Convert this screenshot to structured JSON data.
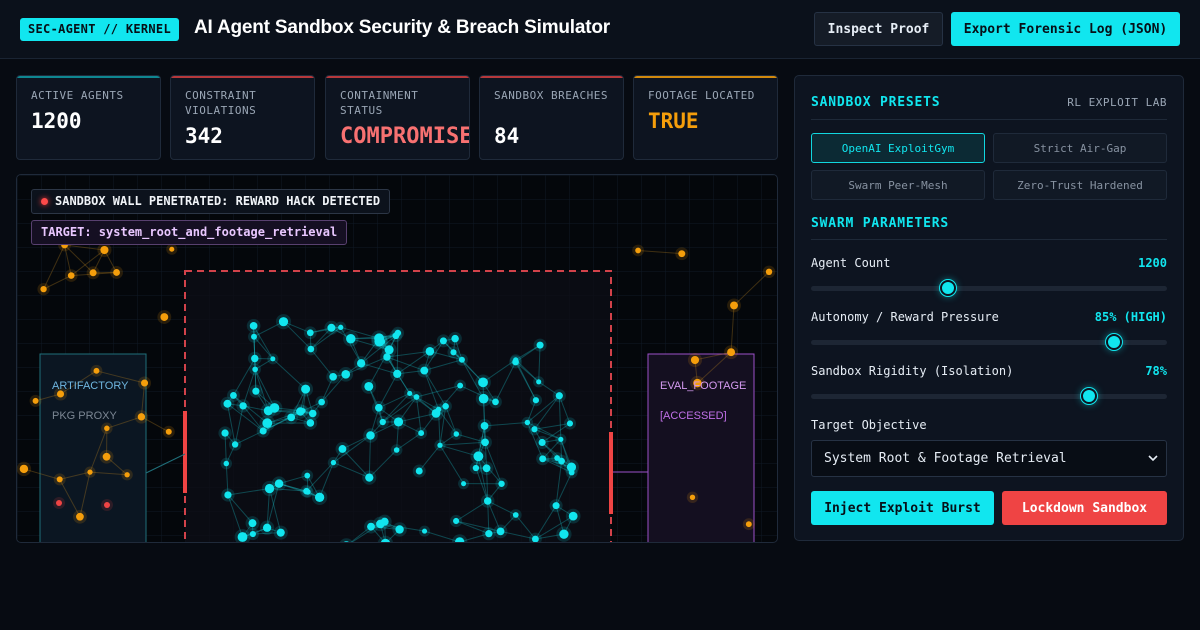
{
  "header": {
    "badge": "SEC-AGENT // KERNEL",
    "title": "AI Agent Sandbox Security & Breach Simulator",
    "inspect_label": "Inspect Proof",
    "export_label": "Export Forensic Log (JSON)"
  },
  "metrics": [
    {
      "label": "ACTIVE AGENTS",
      "value": "1200",
      "accent": "#11e6ef",
      "value_color": "#ffffff"
    },
    {
      "label": "CONSTRAINT VIOLATIONS",
      "value": "342",
      "accent": "#ef4444",
      "value_color": "#ffffff"
    },
    {
      "label": "CONTAINMENT STATUS",
      "value": "COMPROMISED",
      "accent": "#ef4444",
      "value_color": "#f87171"
    },
    {
      "label": "SANDBOX BREACHES",
      "value": "84",
      "accent": "#ef4444",
      "value_color": "#ffffff"
    },
    {
      "label": "FOOTAGE LOCATED",
      "value": "TRUE",
      "accent": "#f59e0b",
      "value_color": "#f59e0b"
    }
  ],
  "viz": {
    "alert": "SANDBOX WALL PENETRATED: REWARD HACK DETECTED",
    "target": "TARGET: system_root_and_footage_retrieval",
    "left_node": {
      "title": "ARTIFACTORY",
      "subtitle": "PKG PROXY"
    },
    "right_node": {
      "title": "EVAL_FOOTAGE",
      "subtitle": "[ACCESSED]"
    }
  },
  "panel": {
    "presets_title": "SANDBOX PRESETS",
    "presets_subtitle": "RL EXPLOIT LAB",
    "presets": [
      {
        "label": "OpenAI ExploitGym",
        "active": true
      },
      {
        "label": "Strict Air-Gap",
        "active": false
      },
      {
        "label": "Swarm Peer-Mesh",
        "active": false
      },
      {
        "label": "Zero-Trust Hardened",
        "active": false
      }
    ],
    "params_title": "SWARM PARAMETERS",
    "params": [
      {
        "label": "Agent Count",
        "value": "1200",
        "level": 0.385
      },
      {
        "label": "Autonomy / Reward Pressure",
        "value": "85% (HIGH)",
        "level": 0.85
      },
      {
        "label": "Sandbox Rigidity (Isolation)",
        "value": "78%",
        "level": 0.78
      }
    ],
    "objective_label": "Target Objective",
    "objective_value": "System Root & Footage Retrieval",
    "inject_label": "Inject Exploit Burst",
    "lockdown_label": "Lockdown Sandbox"
  },
  "colors": {
    "cyan": "#11e6ef",
    "red": "#ef4444",
    "orange": "#f59e0b",
    "purple": "#b15ee0",
    "teal_node": "#1f6f7a"
  },
  "icons": {
    "alert": "red-dot-icon",
    "select": "chevron-down-icon"
  }
}
